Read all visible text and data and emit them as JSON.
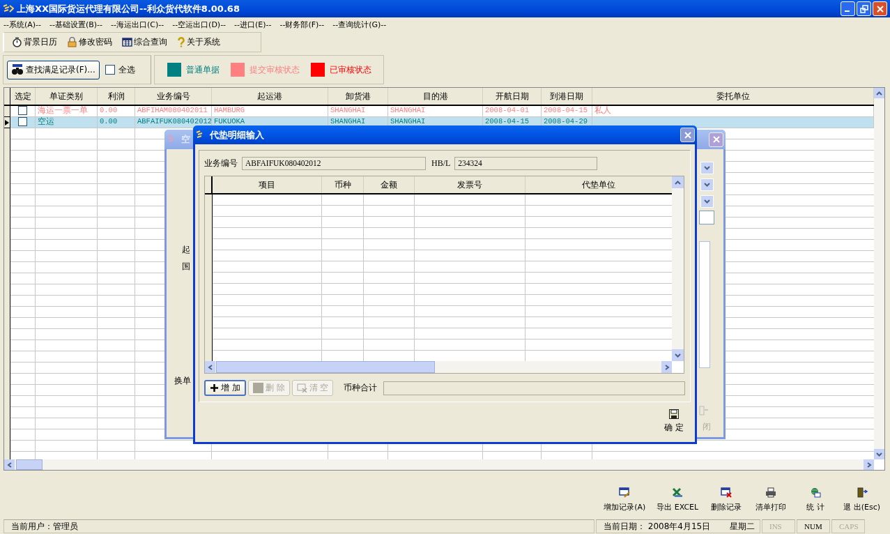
{
  "window": {
    "title": "上海XX国际货运代理有限公司--利众货代软件8.00.68"
  },
  "menu": [
    "--系统(A)--",
    "--基础设置(B)--",
    "--海运出口(C)--",
    "--空运出口(D)--",
    "--进口(E)--",
    "--财务部(F)--",
    "--查询统计(G)--"
  ],
  "toolbar": [
    {
      "label": "背景日历",
      "kind": "clock"
    },
    {
      "label": "修改密码",
      "kind": "lock"
    },
    {
      "label": "综合查询",
      "kind": "calendar"
    },
    {
      "label": "关于系统",
      "kind": "help"
    }
  ],
  "filter": {
    "find_button": "查找满足记录(F)...",
    "select_all": {
      "label": "全选",
      "checked": false
    }
  },
  "legend": [
    {
      "label": "普通单据",
      "color": "#008080"
    },
    {
      "label": "提交审核状态",
      "color": "#ff8080"
    },
    {
      "label": "已审核状态",
      "color": "#ff0000"
    }
  ],
  "table": {
    "select_column": "选定",
    "columns": [
      "单证类别",
      "利润",
      "业务编号",
      "起运港",
      "卸货港",
      "目的港",
      "开航日期",
      "到港日期",
      "委托单位"
    ],
    "rows": [
      {
        "checked": false,
        "selected": false,
        "kind": "submitted",
        "cells": [
          "海运一票一单",
          "0.00",
          "ABFIHAM080402011",
          "HAMBURG",
          "SHANGHAI",
          "SHANGHAI",
          "2008-04-01",
          "2008-04-15",
          "私人"
        ]
      },
      {
        "checked": false,
        "selected": true,
        "kind": "normal",
        "cells": [
          "空运",
          "0.00",
          "ABFAIFUK080402012",
          "FUKUOKA",
          "SHANGHAI",
          "SHANGHAI",
          "2008-04-15",
          "2008-04-29"
        ]
      }
    ]
  },
  "dialog_behind": {
    "title": "空",
    "labels": [
      "起",
      "国",
      "换单"
    ],
    "close_label": "闭"
  },
  "dialog": {
    "title": "代垫明细输入",
    "fields": [
      {
        "label": "业务编号",
        "value": "ABFAIFUK080402012"
      },
      {
        "label": "HB/L",
        "value": "234324"
      }
    ],
    "grid": {
      "columns": [
        "项目",
        "币种",
        "金额",
        "发票号",
        "代垫单位"
      ]
    },
    "buttons": [
      {
        "label": "增 加",
        "kind": "add",
        "disabled": false
      },
      {
        "label": "删 除",
        "kind": "delete",
        "disabled": true
      },
      {
        "label": "清 空",
        "kind": "clear",
        "disabled": true
      }
    ],
    "total": {
      "label": "币种合计"
    },
    "ok_button": "确 定"
  },
  "actions": [
    {
      "label": "增加记录(A)",
      "kind": "add"
    },
    {
      "label": "导出 EXCEL",
      "kind": "excel"
    },
    {
      "label": "删除记录",
      "kind": "delete"
    },
    {
      "label": "清单打印",
      "kind": "print"
    },
    {
      "label": "统 计",
      "kind": "stats"
    },
    {
      "label": "退 出(Esc)",
      "kind": "exit"
    }
  ],
  "status_bar": {
    "user": "当前用户：管理员",
    "date": "当前日期： 2008年4月15日",
    "weekday": "星期二",
    "keys": [
      {
        "label": "INS",
        "on": false
      },
      {
        "label": "NUM",
        "on": true
      },
      {
        "label": "CAPS",
        "on": false
      }
    ]
  }
}
